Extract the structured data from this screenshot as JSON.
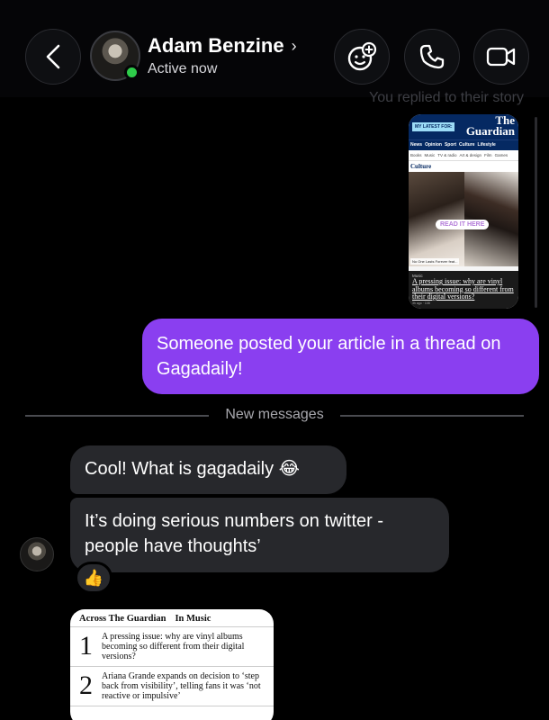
{
  "header": {
    "contact_name": "Adam Benzine",
    "status": "Active now",
    "name_chevron": "›",
    "accent_online": "#2ecc4a"
  },
  "reply_note": "You replied to their story",
  "story_card": {
    "latest_badge": "MY LATEST FOR:",
    "logo_line1": "The",
    "logo_line2": "Guardian",
    "nav": [
      "News",
      "Opinion",
      "Sport",
      "Culture",
      "Lifestyle"
    ],
    "subnav": [
      "Books",
      "Music",
      "TV & radio",
      "Art & design",
      "Film",
      "Games"
    ],
    "section": "Culture",
    "read_badge": "READ IT HERE",
    "caption": "No One Lasts Forever feat...",
    "tag": "Music",
    "headline": "A pressing issue: why are vinyl albums becoming so different from their digital versions?",
    "meta": "3h ago · 108"
  },
  "messages": {
    "outgoing_1": "Someone posted your article in a thread on Gagadaily!",
    "divider": "New messages",
    "incoming_1": "Cool! What is gagadaily 😂",
    "incoming_2": "It’s doing serious numbers on twitter - people have thoughts’",
    "reaction": "👍"
  },
  "list_card": {
    "tab1": "Across The Guardian",
    "tab2": "In Music",
    "items": [
      {
        "num": "1",
        "text": "A pressing issue: why are vinyl albums becoming so different from their digital versions?"
      },
      {
        "num": "2",
        "text": "Ariana Grande expands on decision to ‘step back from visibility’, telling fans it was ‘not reactive or impulsive’"
      }
    ]
  },
  "colors": {
    "outgoing_bubble": "#8a3ff0",
    "incoming_bubble": "#27282c",
    "background": "#000000"
  }
}
